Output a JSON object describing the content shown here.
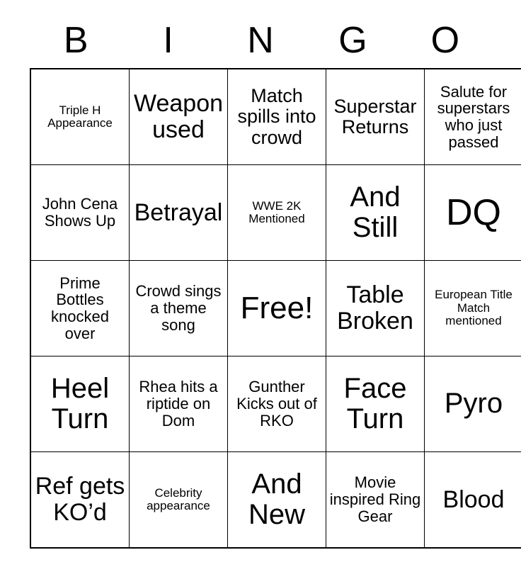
{
  "card": {
    "header_letters": [
      "B",
      "I",
      "N",
      "G",
      "O"
    ],
    "rows": [
      [
        {
          "text": "Triple H Appearance",
          "size": "xs"
        },
        {
          "text": "Weapon used",
          "size": "lg"
        },
        {
          "text": "Match spills into crowd",
          "size": "md"
        },
        {
          "text": "Superstar Returns",
          "size": "md"
        },
        {
          "text": "Salute for superstars who just passed",
          "size": "sm"
        }
      ],
      [
        {
          "text": "John Cena Shows Up",
          "size": "sm"
        },
        {
          "text": "Betrayal",
          "size": "lg"
        },
        {
          "text": "WWE 2K Mentioned",
          "size": "xs"
        },
        {
          "text": "And Still",
          "size": "xl"
        },
        {
          "text": "DQ",
          "size": "max"
        }
      ],
      [
        {
          "text": "Prime Bottles knocked over",
          "size": "sm"
        },
        {
          "text": "Crowd sings a theme song",
          "size": "sm"
        },
        {
          "text": "Free!",
          "size": "xxl"
        },
        {
          "text": "Table Broken",
          "size": "lg"
        },
        {
          "text": "European Title Match mentioned",
          "size": "xs"
        }
      ],
      [
        {
          "text": "Heel Turn",
          "size": "xl"
        },
        {
          "text": "Rhea hits a riptide on Dom",
          "size": "sm"
        },
        {
          "text": "Gunther Kicks out of RKO",
          "size": "sm"
        },
        {
          "text": "Face Turn",
          "size": "xl"
        },
        {
          "text": "Pyro",
          "size": "xl"
        }
      ],
      [
        {
          "text": "Ref gets KO’d",
          "size": "lg"
        },
        {
          "text": "Celebrity appearance",
          "size": "xs"
        },
        {
          "text": "And New",
          "size": "xl"
        },
        {
          "text": "Movie inspired Ring Gear",
          "size": "sm"
        },
        {
          "text": "Blood",
          "size": "lg"
        }
      ]
    ]
  },
  "colors": {
    "background": "#ffffff",
    "ink": "#000000",
    "grid_line": "#000000"
  }
}
